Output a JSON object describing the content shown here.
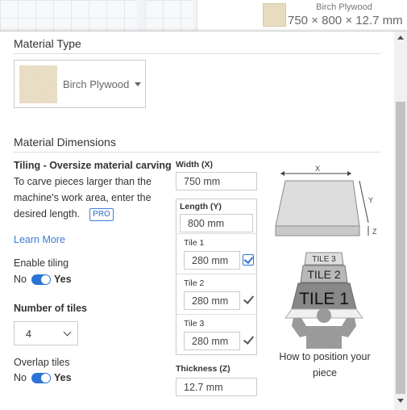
{
  "top_card": {
    "material_name": "Birch Plywood",
    "material_dims": "750 × 800 × 12.7 mm"
  },
  "material_type": {
    "title": "Material Type",
    "selected": "Birch Plywood"
  },
  "material_dimensions": {
    "title": "Material Dimensions",
    "tiling_heading": "Tiling - Oversize material carving",
    "desc_line1": "To carve pieces larger than the",
    "desc_line2": "machine's work area, enter the",
    "desc_line3": "desired length.",
    "pro_badge": "PRO",
    "learn_more": "Learn More",
    "enable_tiling": {
      "label": "Enable tiling",
      "no": "No",
      "yes": "Yes",
      "state": "yes"
    },
    "number_of_tiles": {
      "label": "Number of tiles",
      "value": "4"
    },
    "overlap_tiles": {
      "label": "Overlap tiles",
      "no": "No",
      "yes": "Yes",
      "state": "yes"
    },
    "width": {
      "label": "Width (X)",
      "value": "750 mm"
    },
    "length": {
      "label": "Length (Y)",
      "value": "800 mm"
    },
    "tiles": [
      {
        "label": "Tile 1",
        "value": "280 mm",
        "check": "blue"
      },
      {
        "label": "Tile 2",
        "value": "280 mm",
        "check": "gray"
      },
      {
        "label": "Tile 3",
        "value": "280 mm",
        "check": "gray"
      }
    ],
    "thickness": {
      "label": "Thickness (Z)",
      "value": "12.7 mm"
    }
  },
  "diagram": {
    "axis_x": "X",
    "axis_y": "Y",
    "axis_z": "Z",
    "tile_labels": [
      "TILE 3",
      "TILE 2",
      "TILE 1"
    ],
    "caption_line1": "How to position your",
    "caption_line2": "piece"
  },
  "colors": {
    "accent": "#2b74d6",
    "link": "#3a7bd5",
    "material": "#e6dbbf"
  }
}
